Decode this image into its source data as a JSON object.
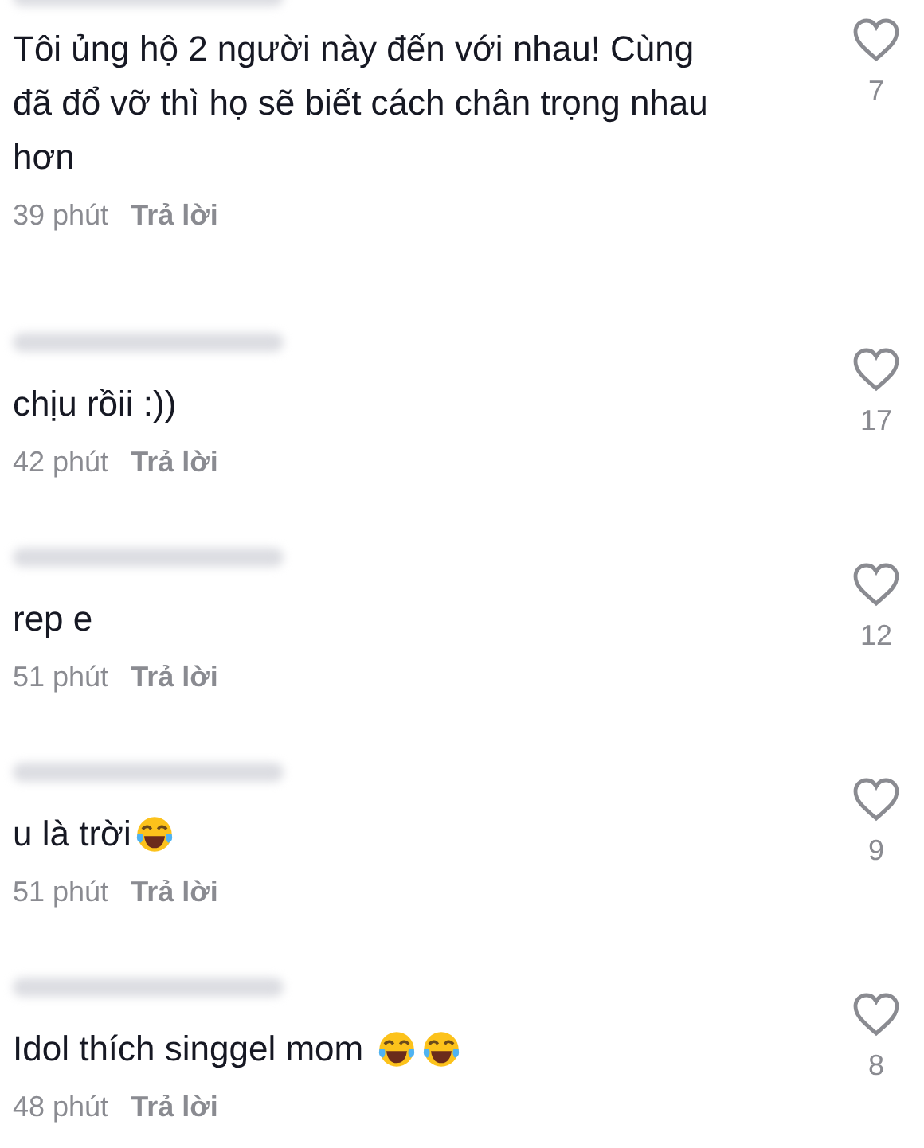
{
  "comments": [
    {
      "text": "Tôi ủng hộ 2 người này đến với nhau! Cùng đã đổ vỡ thì họ sẽ biết cách chân trọng nhau hơn",
      "time": "39 phút",
      "reply": "Trả lời",
      "likes": "7",
      "liked": false
    },
    {
      "text": "chịu rồii :))",
      "time": "42 phút",
      "reply": "Trả lời",
      "likes": "17",
      "liked": false
    },
    {
      "text": "rep e",
      "time": "51 phút",
      "reply": "Trả lời",
      "likes": "12",
      "liked": false
    },
    {
      "text": "u là trời",
      "emojis": [
        {
          "kind": "laugh"
        }
      ],
      "time": "51 phút",
      "reply": "Trả lời",
      "likes": "9",
      "liked": false
    },
    {
      "text": "Idol thích singgel mom ",
      "emojis": [
        {
          "kind": "laugh"
        },
        {
          "kind": "laugh"
        }
      ],
      "time": "48 phút",
      "reply": "Trả lời",
      "likes": "8",
      "liked": false
    }
  ]
}
